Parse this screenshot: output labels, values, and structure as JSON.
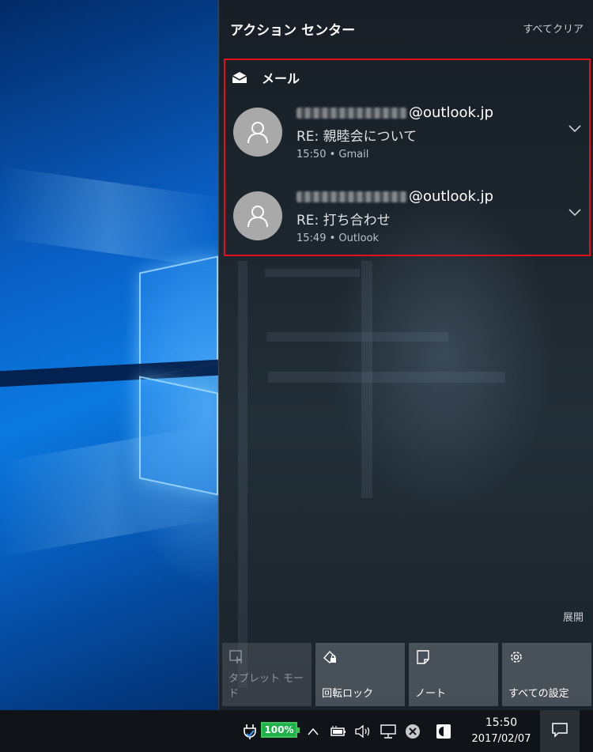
{
  "action_center": {
    "title": "アクション センター",
    "clear_all": "すべてクリア",
    "mail_group": {
      "app_name": "メール",
      "notifications": [
        {
          "sender_suffix": "@outlook.jp",
          "subject": "RE: 親睦会について",
          "meta": "15:50 • Gmail"
        },
        {
          "sender_suffix": "@outlook.jp",
          "subject": "RE: 打ち合わせ",
          "meta": "15:49 • Outlook"
        }
      ]
    },
    "expand": "展開",
    "quick_actions": [
      {
        "label": "タブレット モード",
        "icon": "tablet-mode-icon",
        "enabled": false
      },
      {
        "label": "回転ロック",
        "icon": "rotation-lock-icon",
        "enabled": true
      },
      {
        "label": "ノート",
        "icon": "note-icon",
        "enabled": true
      },
      {
        "label": "すべての設定",
        "icon": "gear-icon",
        "enabled": true
      }
    ]
  },
  "taskbar": {
    "battery_percent": "100%",
    "time": "15:50",
    "date": "2017/02/07"
  },
  "colors": {
    "highlight_border": "#e0101c",
    "battery_green": "#1fb04a",
    "avatar_gray": "#a9a9a9"
  }
}
